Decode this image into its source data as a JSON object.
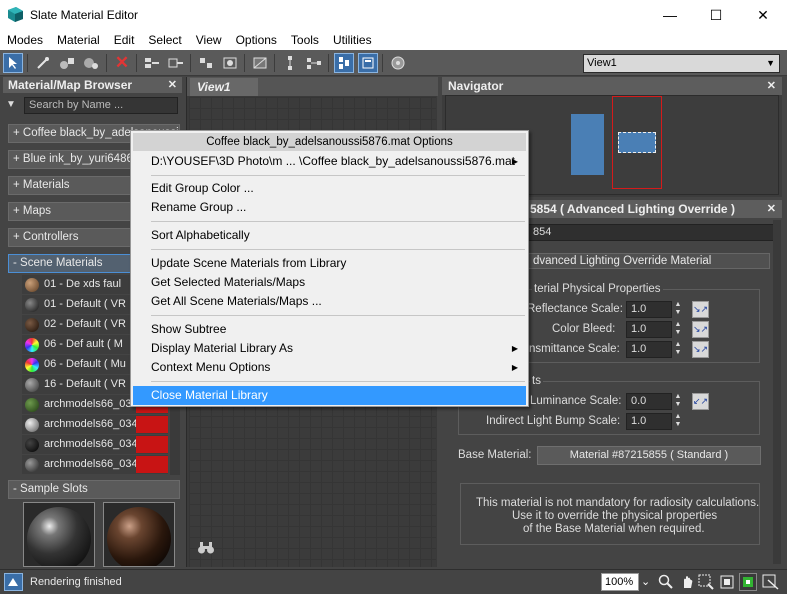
{
  "window": {
    "title": "Slate Material Editor",
    "minimize_glyph": "—",
    "maximize_glyph": "☐",
    "close_glyph": "✕"
  },
  "menubar": [
    "Modes",
    "Material",
    "Edit",
    "Select",
    "View",
    "Options",
    "Tools",
    "Utilities"
  ],
  "toolbar": {
    "view_select": "View1"
  },
  "browser": {
    "title": "Material/Map Browser",
    "close_glyph": "✕",
    "search_placeholder": "Search by Name ...",
    "categories": [
      "+ Coffee black_by_adelsanoussi5876",
      "+ Blue ink_by_yuri6486",
      "+ Materials",
      "+ Maps",
      "+ Controllers"
    ],
    "scene_materials_label": "- Scene Materials",
    "scene_materials": [
      "01 - De    xds faul",
      "01 - Default  ( VR",
      "02 - Default  ( VR",
      "06 - Def    ault  ( M",
      "06 - Default  ( Mu",
      "16 - Default  ( VR",
      "archmodels66_034_0",
      "archmodels66_034_0",
      "archmodels66_034_0",
      "archmodels66_034_0"
    ],
    "sample_slots_label": "- Sample Slots"
  },
  "view1": {
    "tab_label": "View1"
  },
  "navigator": {
    "title": "Navigator",
    "close_glyph": "✕"
  },
  "properties": {
    "header": "5854  ( Advanced Lighting Override )",
    "name_field": "854",
    "rollout_title": "dvanced Lighting Override Material",
    "group1_title": "terial Physical Properties",
    "reflectance_label": "Reflectance Scale:",
    "reflectance_value": "1.0",
    "color_bleed_label": "Color Bleed:",
    "color_bleed_value": "1.0",
    "transmittance_label": "nsmittance Scale:",
    "transmittance_value": "1.0",
    "group2_title": "ts",
    "luminance_label": "Luminance Scale:",
    "luminance_value": "0.0",
    "bump_label": "Indirect Light Bump Scale:",
    "bump_value": "1.0",
    "base_material_label": "Base Material:",
    "base_material_value": "Material #87215855  ( Standard )",
    "note_line1": "This material is not mandatory for radiosity calculations.",
    "note_line2": "Use it to override the physical properties",
    "note_line3": "of the Base Material when required."
  },
  "statusbar": {
    "text": "Rendering finished",
    "zoom": "100%"
  },
  "context_menu": {
    "title": "Coffee black_by_adelsanoussi5876.mat Options",
    "path_item": "D:\\YOUSEF\\3D Photo\\m ... \\Coffee black_by_adelsanoussi5876.mat",
    "edit_group_color": "Edit Group Color ...",
    "rename_group": "Rename Group ...",
    "sort_alpha": "Sort Alphabetically",
    "update_scene": "Update Scene Materials from Library",
    "get_selected": "Get Selected Materials/Maps",
    "get_all": "Get All Scene Materials/Maps ...",
    "show_subtree": "Show Subtree",
    "display_as": "Display Material Library As",
    "context_options": "Context Menu Options",
    "close_library": "Close Material Library",
    "submenu_glyph": "▶"
  },
  "colors": {
    "highlight": "#3399ff",
    "accent_red": "#c81414",
    "node_blue": "#4a7fb5"
  }
}
